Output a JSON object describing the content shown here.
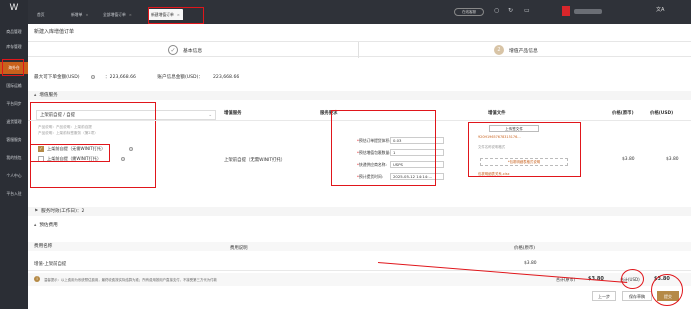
{
  "topbar": {
    "logo_icon": "logo-w",
    "tabs": [
      {
        "label": "首页"
      },
      {
        "label": "新增单"
      },
      {
        "label": "全部增值订单"
      },
      {
        "label": "新建增值订单"
      }
    ],
    "service_label": "在线客服",
    "lang": "文A"
  },
  "sidebar": {
    "items": [
      {
        "label": "商品管理"
      },
      {
        "label": "库存管理"
      },
      {
        "label": "海外仓"
      },
      {
        "label": "国际运输"
      },
      {
        "label": "平台同步"
      },
      {
        "label": "退货管理"
      },
      {
        "label": "客服服务"
      },
      {
        "label": "我的钱包"
      },
      {
        "label": "个人中心"
      },
      {
        "label": "平台入驻"
      }
    ]
  },
  "page": {
    "title": "新建入库增值订单",
    "step1": "基本信息",
    "step2": "增值产品信息",
    "step2_num": "2"
  },
  "limits": {
    "max_available": "最大可下单金额(USD)",
    "max_value": "223,668.66",
    "account_balance": "账户信息金额(USD)：",
    "balance_value": "223,668.66"
  },
  "sections": {
    "vas": "增值服务",
    "timeliness": "服务时效(工作日)：2",
    "fees": "预估费用"
  },
  "left": {
    "select_value": "上架前自提 / 自提",
    "line1": "产品说明：产品说明：上架前自提",
    "line2": "产品说明：上架前标签服务（第2项）",
    "opt1": "上架前自提（无需WINIT打托）",
    "opt2": "上架前自提（需WINIT打托）"
  },
  "table": {
    "col_service": "增值服务",
    "col_req": "服务要求",
    "col_file": "增值文件",
    "col_price_orig": "价格(原币)",
    "col_price_usd": "价格(USD)",
    "service_name": "上架前自提（无需WINIT打托）",
    "price_orig": "$3.80",
    "price_usd": "$3.80"
  },
  "form": {
    "f1_label": "预估订单提货体积:",
    "f1_value": "0.03",
    "f2_label": "预估增值包裹数量:",
    "f2_value": "1",
    "f3_label": "快递供应商名称:",
    "f3_value": "USPS",
    "f4_label": "预计提货时间:",
    "f4_value": "2025-05-12 14:14:…"
  },
  "files": {
    "upload_label": "上传签文件",
    "file1": "920H19657678315176…",
    "file_note": "文件名称说明格式",
    "upload2_label": "*包裹明细表格式说明",
    "file2": "包裹明细表关系.xlsx"
  },
  "fees": {
    "col_name": "费用名称",
    "col_desc": "费用说明",
    "col_price": "价格(原币)",
    "row_name": "增值-上架前自提",
    "row_price": "$3.80"
  },
  "tip": "温馨提示：以上费用为系统预估费用，最终收费按实际结算为准；所有费用按用户直接支付，不接受第三方代为付款",
  "footer": {
    "total_label": "合计(原币)",
    "total_value": "$3.80",
    "total_usd_label": "合计(USD)",
    "total_usd_value": "$3.80",
    "prev": "上一步",
    "save": "保存草稿",
    "submit": "提交"
  }
}
